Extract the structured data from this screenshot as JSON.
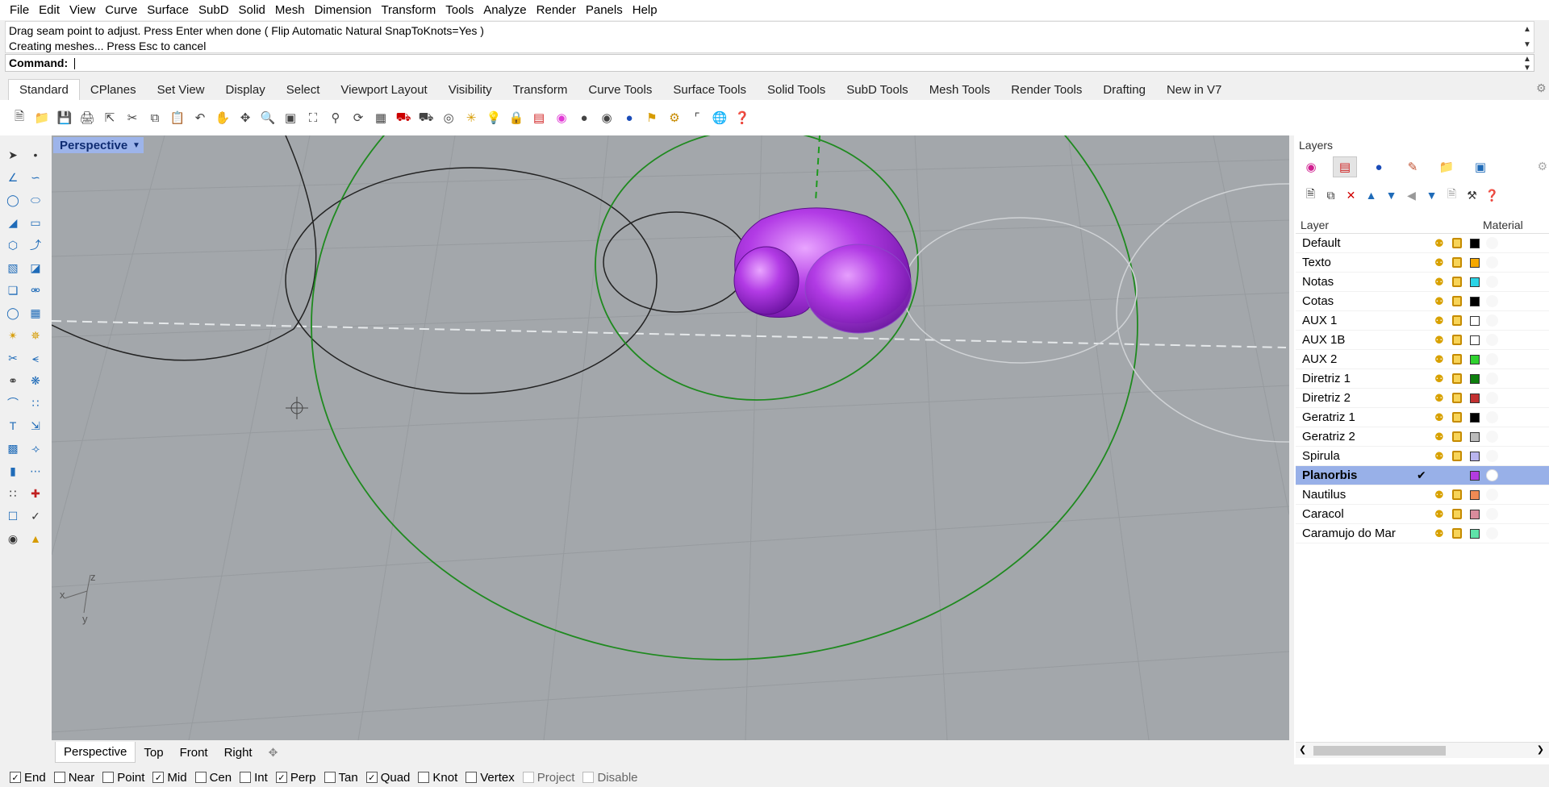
{
  "menu": [
    "File",
    "Edit",
    "View",
    "Curve",
    "Surface",
    "SubD",
    "Solid",
    "Mesh",
    "Dimension",
    "Transform",
    "Tools",
    "Analyze",
    "Render",
    "Panels",
    "Help"
  ],
  "command_history": {
    "line1": "Drag seam point to adjust. Press Enter when done ( Flip  Automatic  Natural  SnapToKnots=Yes )",
    "line2": "Creating meshes... Press Esc to cancel"
  },
  "command_prompt": "Command:",
  "toolbar_tabs": [
    "Standard",
    "CPlanes",
    "Set View",
    "Display",
    "Select",
    "Viewport Layout",
    "Visibility",
    "Transform",
    "Curve Tools",
    "Surface Tools",
    "Solid Tools",
    "SubD Tools",
    "Mesh Tools",
    "Render Tools",
    "Drafting",
    "New in V7"
  ],
  "viewport": {
    "title": "Perspective",
    "axis_x": "x",
    "axis_y": "y",
    "axis_z": "z"
  },
  "viewport_tabs": [
    "Perspective",
    "Top",
    "Front",
    "Right"
  ],
  "osnaps": [
    {
      "label": "End",
      "checked": true
    },
    {
      "label": "Near",
      "checked": false
    },
    {
      "label": "Point",
      "checked": false
    },
    {
      "label": "Mid",
      "checked": true
    },
    {
      "label": "Cen",
      "checked": false
    },
    {
      "label": "Int",
      "checked": false
    },
    {
      "label": "Perp",
      "checked": true
    },
    {
      "label": "Tan",
      "checked": false
    },
    {
      "label": "Quad",
      "checked": true
    },
    {
      "label": "Knot",
      "checked": false
    },
    {
      "label": "Vertex",
      "checked": false
    },
    {
      "label": "Project",
      "checked": false,
      "disabled": true
    },
    {
      "label": "Disable",
      "checked": false,
      "disabled": true
    }
  ],
  "layers_panel": {
    "title": "Layers",
    "col_layer": "Layer",
    "col_material": "Material",
    "layers": [
      {
        "name": "Default",
        "color": "#000000"
      },
      {
        "name": "Texto",
        "color": "#f5a800"
      },
      {
        "name": "Notas",
        "color": "#2ad4e6"
      },
      {
        "name": "Cotas",
        "color": "#000000"
      },
      {
        "name": "AUX 1",
        "color": "#ffffff"
      },
      {
        "name": "AUX 1B",
        "color": "#ffffff"
      },
      {
        "name": "AUX 2",
        "color": "#2fd22f"
      },
      {
        "name": "Diretriz 1",
        "color": "#0e7f0e"
      },
      {
        "name": "Diretriz 2",
        "color": "#c23030"
      },
      {
        "name": "Geratriz 1",
        "color": "#000000"
      },
      {
        "name": "Geratriz 2",
        "color": "#bbbbbb"
      },
      {
        "name": "Spirula",
        "color": "#b9b4ee"
      },
      {
        "name": "Planorbis",
        "color": "#b33ce0",
        "current": true
      },
      {
        "name": "Nautilus",
        "color": "#ef8a54"
      },
      {
        "name": "Caracol",
        "color": "#d98c9c"
      },
      {
        "name": "Caramujo do Mar",
        "color": "#5fe3a9"
      }
    ]
  }
}
